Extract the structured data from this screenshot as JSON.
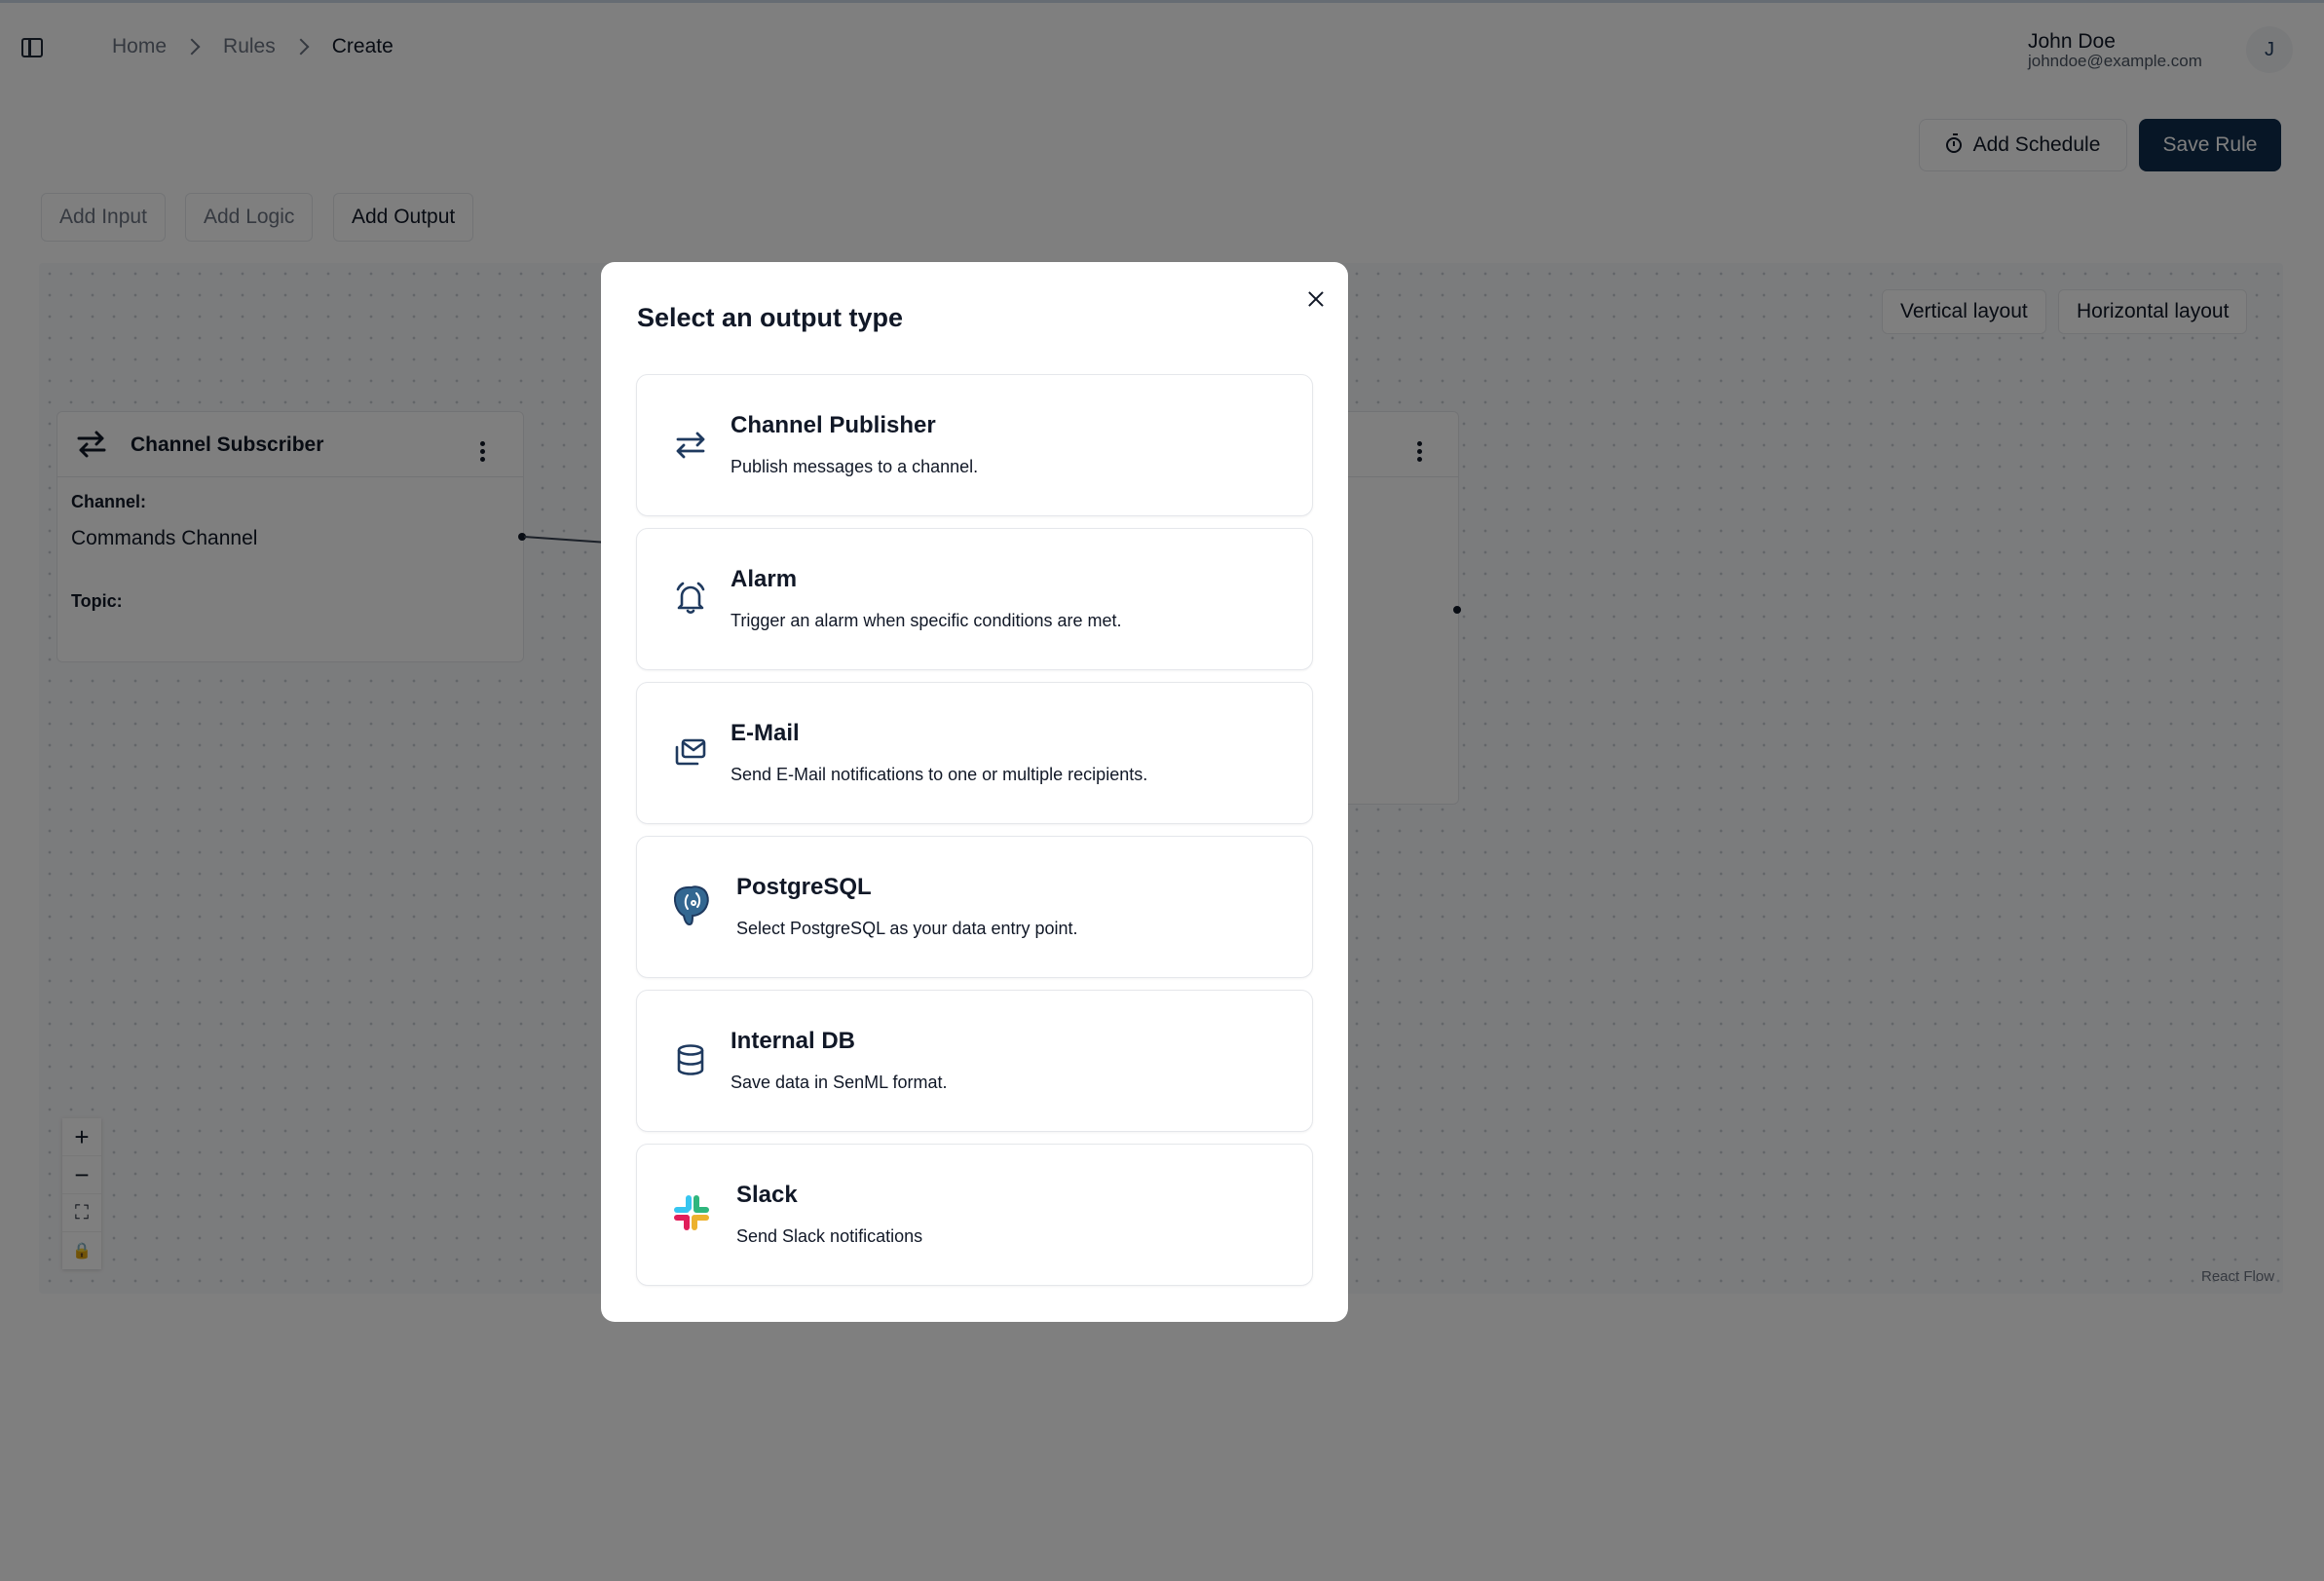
{
  "header": {
    "breadcrumb": [
      "Home",
      "Rules",
      "Create"
    ],
    "user_name": "John Doe",
    "user_email": "johndoe@example.com",
    "avatar_initial": "J"
  },
  "actions": {
    "add_schedule": "Add Schedule",
    "save_rule": "Save Rule"
  },
  "node_tabs": {
    "add_input": "Add Input",
    "add_logic": "Add Logic",
    "add_output": "Add Output"
  },
  "canvas": {
    "vertical_layout": "Vertical layout",
    "horizontal_layout": "Horizontal layout",
    "attribution": "React Flow",
    "controls": [
      "+",
      "−",
      "⛶",
      "🔒"
    ]
  },
  "input_node": {
    "title": "Channel Subscriber",
    "channel_label": "Channel:",
    "channel_value": "Commands Channel",
    "topic_label": "Topic:"
  },
  "modal": {
    "title": "Select an output type",
    "options": [
      {
        "icon": "arrows-swap-icon",
        "title": "Channel Publisher",
        "description": "Publish messages to a channel."
      },
      {
        "icon": "bell-icon",
        "title": "Alarm",
        "description": "Trigger an alarm when specific conditions are met."
      },
      {
        "icon": "mail-icon",
        "title": "E-Mail",
        "description": "Send E-Mail notifications to one or multiple recipients."
      },
      {
        "icon": "postgresql-icon",
        "title": "PostgreSQL",
        "description": "Select PostgreSQL as your data entry point."
      },
      {
        "icon": "database-icon",
        "title": "Internal DB",
        "description": "Save data in SenML format."
      },
      {
        "icon": "slack-icon",
        "title": "Slack",
        "description": "Send Slack notifications"
      }
    ]
  },
  "colors": {
    "primary": "#0f2c4d",
    "icon": "#1f3a5f",
    "overlay": "rgba(0,0,0,0.5)"
  }
}
